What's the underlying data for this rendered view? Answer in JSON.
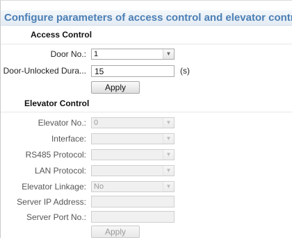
{
  "header": {
    "title": "Configure parameters of access control and elevator control."
  },
  "access_control": {
    "title": "Access Control",
    "door_no_label": "Door No.:",
    "door_no_value": "1",
    "door_unlocked_label": "Door-Unlocked Dura...",
    "door_unlocked_value": "15",
    "door_unlocked_unit": "(s)",
    "apply_label": "Apply"
  },
  "elevator_control": {
    "title": "Elevator Control",
    "elevator_no_label": "Elevator No.:",
    "elevator_no_value": "0",
    "interface_label": "Interface:",
    "interface_value": "",
    "rs485_label": "RS485 Protocol:",
    "rs485_value": "",
    "lan_label": "LAN Protocol:",
    "lan_value": "",
    "linkage_label": "Elevator Linkage:",
    "linkage_value": "No",
    "server_ip_label": "Server IP Address:",
    "server_ip_value": "",
    "server_port_label": "Server Port No.:",
    "server_port_value": "",
    "apply_label": "Apply"
  },
  "icons": {
    "dropdown": "chevron-down-icon"
  },
  "colors": {
    "header_text": "#4c7fb5",
    "header_bg": "#e3ebf3",
    "disabled_bg": "#f0f0f0"
  }
}
